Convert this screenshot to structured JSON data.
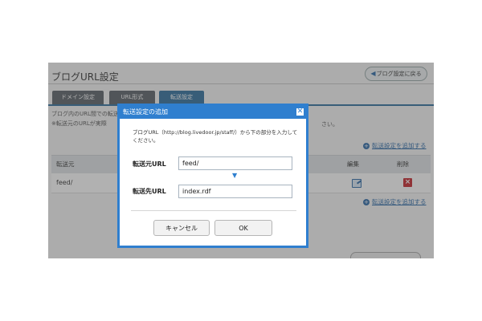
{
  "page": {
    "title": "ブログURL設定",
    "back_button": "ブログ設定に戻る",
    "tabs": [
      {
        "label": "ドメイン設定"
      },
      {
        "label": "URL形式"
      },
      {
        "label": "転送設定"
      }
    ],
    "info_line1": "ブログ内のURL間での転送",
    "info_line2": "※転送元のURLが実際",
    "info_tail": "さい。",
    "add_transfer_link": "転送設定を追加する",
    "table": {
      "columns": [
        "転送元",
        "編集",
        "削除"
      ],
      "rows": [
        {
          "source": "feed/"
        }
      ]
    }
  },
  "dialog": {
    "title": "転送設定の追加",
    "close_icon": "close-icon",
    "description": "ブログURL（http://blog.livedoor.jp/staff/）から下の部分を入力してください。",
    "source_label": "転送元URL",
    "source_value": "feed/",
    "dest_label": "転送先URL",
    "dest_value": "index.rdf",
    "cancel_label": "キャンセル",
    "ok_label": "OK"
  },
  "colors": {
    "accent": "#2f7fcf",
    "tab_active": "#2f6f9d",
    "tab_inactive": "#5b6168",
    "delete": "#c7262d"
  }
}
